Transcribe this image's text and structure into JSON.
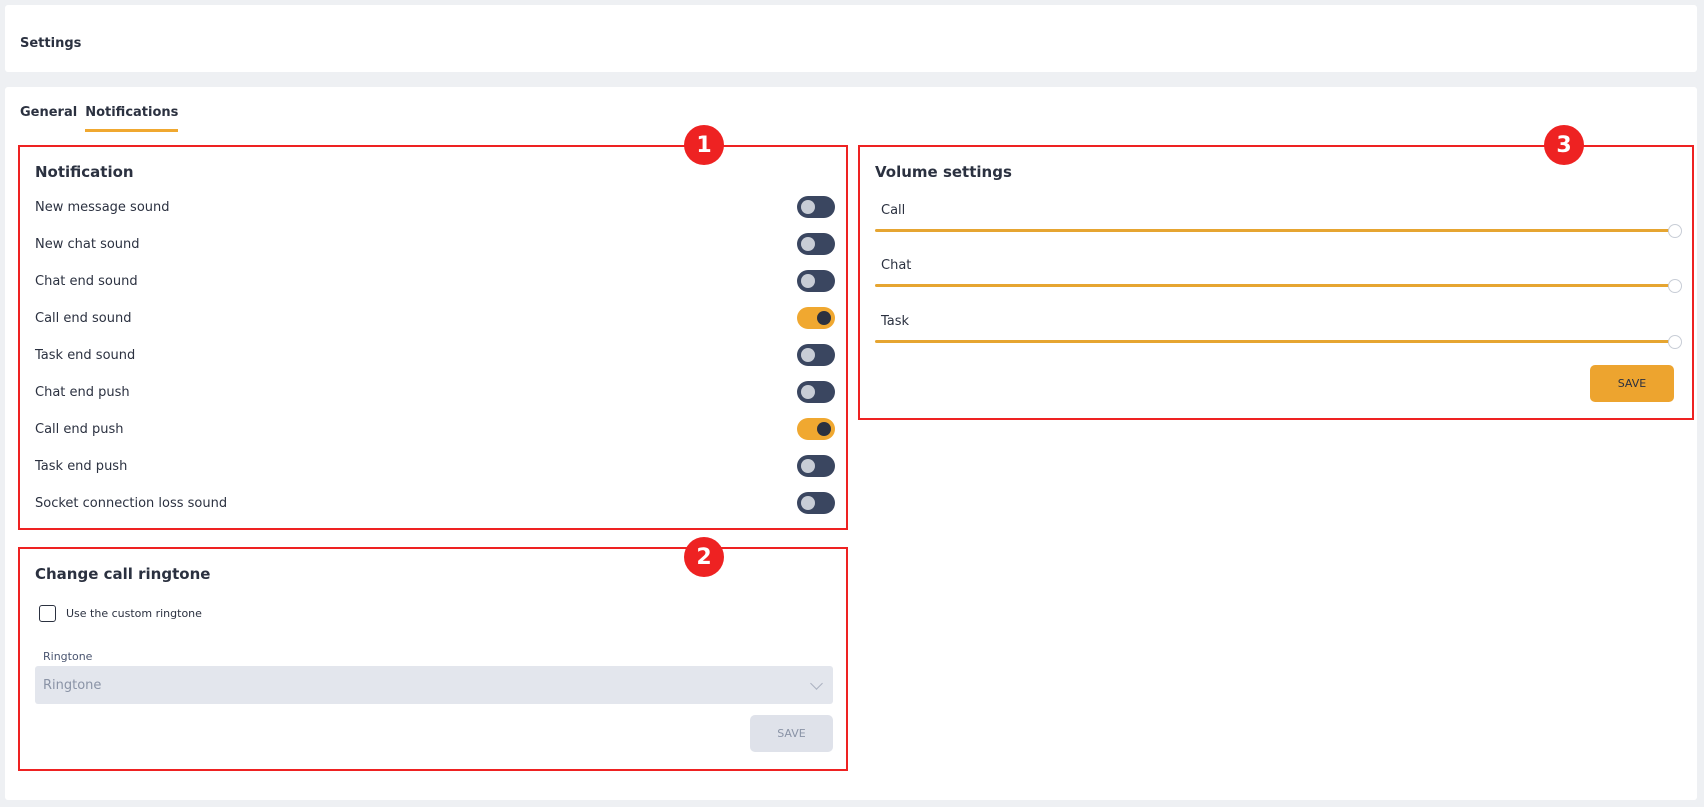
{
  "header": {
    "title": "Settings"
  },
  "tabs": [
    {
      "label": "General",
      "active": false
    },
    {
      "label": "Notifications",
      "active": true
    }
  ],
  "notification": {
    "badge": "1",
    "title": "Notification",
    "items": [
      {
        "label": "New message sound",
        "on": false
      },
      {
        "label": "New chat sound",
        "on": false
      },
      {
        "label": "Chat end sound",
        "on": false
      },
      {
        "label": "Call end sound",
        "on": true
      },
      {
        "label": "Task end sound",
        "on": false
      },
      {
        "label": "Chat end push",
        "on": false
      },
      {
        "label": "Call end push",
        "on": true
      },
      {
        "label": "Task end push",
        "on": false
      },
      {
        "label": "Socket connection loss sound",
        "on": false
      }
    ]
  },
  "ringtone": {
    "badge": "2",
    "title": "Change call ringtone",
    "checkbox_label": "Use the custom ringtone",
    "field_label": "Ringtone",
    "select_placeholder": "Ringtone",
    "save_label": "SAVE"
  },
  "volume": {
    "badge": "3",
    "title": "Volume settings",
    "sliders": [
      {
        "label": "Call",
        "value": 100
      },
      {
        "label": "Chat",
        "value": 100
      },
      {
        "label": "Task",
        "value": 100
      }
    ],
    "save_label": "SAVE"
  },
  "colors": {
    "accent": "#eda42f",
    "highlight_box": "#ee2222",
    "toggle_off": "#3a4660"
  }
}
